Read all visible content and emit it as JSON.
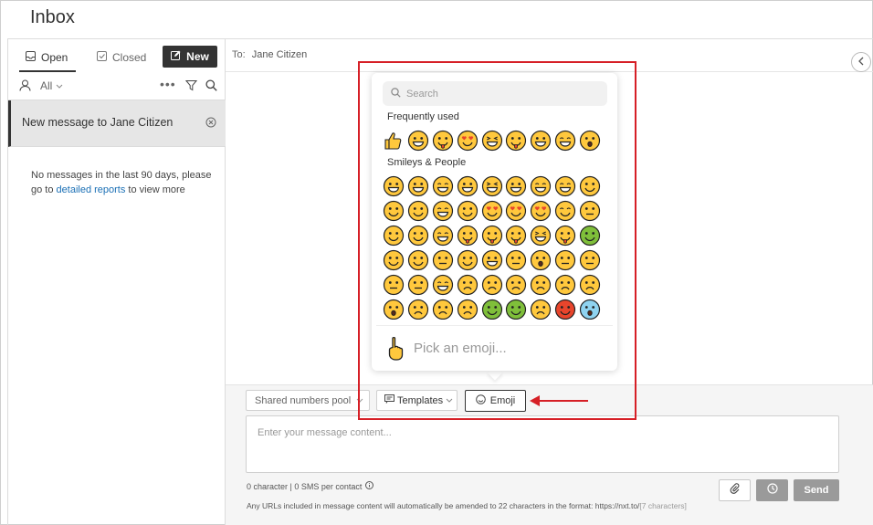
{
  "title": "Inbox",
  "sidebar": {
    "tabs": [
      {
        "label": "Open"
      },
      {
        "label": "Closed"
      }
    ],
    "new_button": "New",
    "filter_label": "All",
    "conversation": {
      "label": "New message to Jane Citizen"
    },
    "empty_text_before": "No messages in the last 90 days, please go to ",
    "empty_link": "detailed reports",
    "empty_text_after": " to view more"
  },
  "thread": {
    "to_label": "To:",
    "to_name": "Jane Citizen"
  },
  "emoji_picker": {
    "search_placeholder": "Search",
    "categories": [
      {
        "label": "Frequently used"
      },
      {
        "label": "Smileys & People"
      }
    ],
    "footer_placeholder": "Pick an emoji..."
  },
  "compose": {
    "shared_numbers": "Shared numbers pool",
    "templates": "Templates",
    "emoji": "Emoji",
    "placeholder": "Enter your message content...",
    "counter": "0 character | 0 SMS per contact",
    "note": "Any URLs included in message content will automatically be amended to 22 characters in the format: https://nxt.to/",
    "note_suffix": "[7 characters]",
    "send": "Send"
  },
  "colors": {
    "accent": "#333333",
    "highlight": "#d61f26",
    "link": "#1a6fb5",
    "emoji_yellow": "#ffc83d"
  }
}
